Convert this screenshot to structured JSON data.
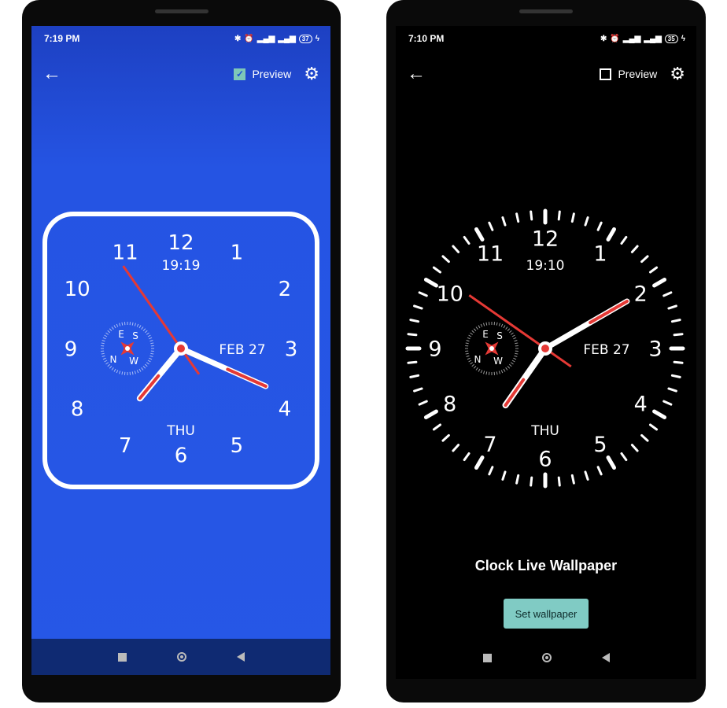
{
  "colors": {
    "blue_bg_top": "#1f45c9",
    "blue_bg": "#2657e6",
    "blue_nav": "#0f2a72",
    "accent_red": "#e53935",
    "button_teal": "#80cbc4"
  },
  "left_phone": {
    "status": {
      "time": "7:19 PM",
      "battery": "37"
    },
    "toolbar": {
      "back_icon": "arrow-left-icon",
      "preview_label": "Preview",
      "preview_checked": true,
      "settings_icon": "gear-icon"
    },
    "clock": {
      "numbers": [
        "12",
        "1",
        "2",
        "3",
        "4",
        "5",
        "6",
        "7",
        "8",
        "9",
        "10",
        "11"
      ],
      "digital_time": "19:19",
      "date": "FEB 27",
      "day": "THU",
      "compass": [
        "E",
        "S",
        "N",
        "W"
      ],
      "time": "7:19"
    }
  },
  "right_phone": {
    "status": {
      "time": "7:10 PM",
      "battery": "35"
    },
    "toolbar": {
      "back_icon": "arrow-left-icon",
      "preview_label": "Preview",
      "preview_checked": false,
      "settings_icon": "gear-icon"
    },
    "clock": {
      "numbers": [
        "12",
        "1",
        "2",
        "3",
        "4",
        "5",
        "6",
        "7",
        "8",
        "9",
        "10",
        "11"
      ],
      "digital_time": "19:10",
      "date": "FEB 27",
      "day": "THU",
      "compass": [
        "E",
        "S",
        "N",
        "W"
      ],
      "time": "7:10"
    },
    "title": "Clock Live Wallpaper",
    "set_wallpaper_label": "Set wallpaper"
  }
}
